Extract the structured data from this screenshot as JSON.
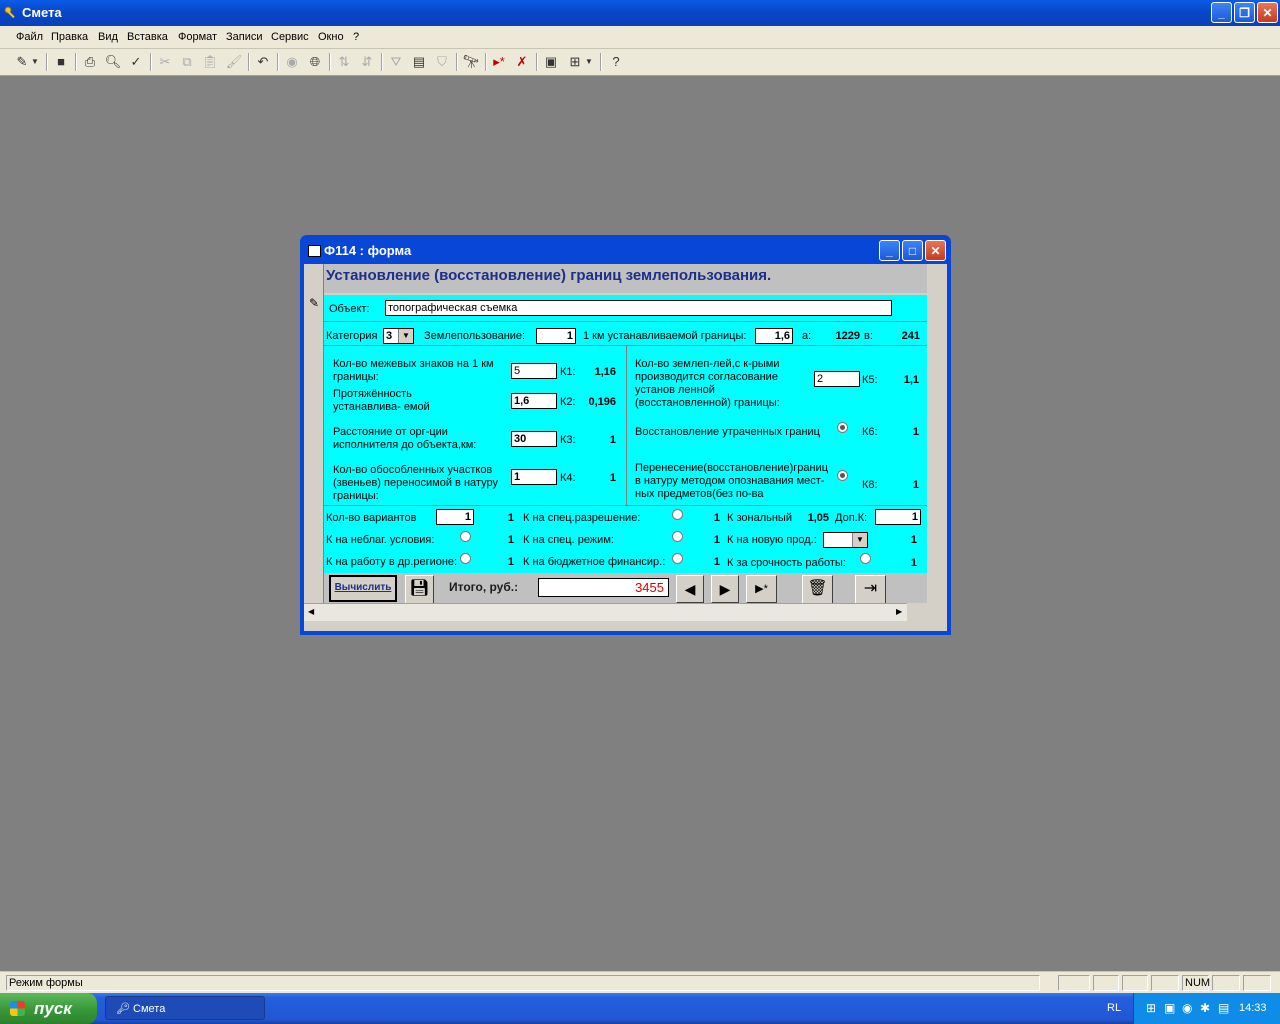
{
  "app": {
    "title": "Смета"
  },
  "menu": [
    "Файл",
    "Правка",
    "Вид",
    "Вставка",
    "Формат",
    "Записи",
    "Сервис",
    "Окно",
    "?"
  ],
  "form": {
    "title": "Ф114 : форма",
    "heading": "Установление (восстановление) границ землепользования.",
    "object_label": "Объект:",
    "object_value": "топографическая съемка",
    "category_label": "Категория",
    "category_value": "3",
    "landuse_label": "Землепользование:",
    "landuse_value": "1",
    "km_label": "1 км устанавливаемой границы:",
    "km_value": "1,6",
    "a_label": "а:",
    "a_value": "1229",
    "v_label": "в:",
    "v_value": "241",
    "left": [
      {
        "label": "Кол-во межевых знаков   на 1 км границы:",
        "input": "5",
        "k_label": "К1:",
        "k_value": "1,16"
      },
      {
        "label": "Протяжённость устанавлива- емой границы:",
        "input": "1,6",
        "k_label": "К2:",
        "k_value": "0,196"
      },
      {
        "label": "Расстояние от орг-ции исполнителя до объекта,км:",
        "input": "30",
        "k_label": "К3:",
        "k_value": "1"
      },
      {
        "label": "Кол-во обособленных участков (звеньев) переносимой в натуру границы:",
        "input": "1",
        "k_label": "К4:",
        "k_value": "1"
      }
    ],
    "right": [
      {
        "label": "Кол-во землеп-лей,с к-рыми производится согласование установ ленной (восстановленной) границы:",
        "input": "2",
        "k_label": "К5:",
        "k_value": "1,1"
      },
      {
        "label": "Восстановление утраченных границ",
        "k_label": "К6:",
        "k_value": "1"
      },
      {
        "label": "Перенесение(восстановление)границ в натуру методом опознавания мест- ных предметов(без по-ва",
        "k_label": "К8:",
        "k_value": "1"
      }
    ],
    "variants_label": "Кол-во вариантов",
    "variants_value": "1",
    "variants_k": "1",
    "unfav_label": "К на неблаг. условия:",
    "unfav_k": "1",
    "region_label": "К на работу в др.регионе:",
    "region_k": "1",
    "spec_perm_label": "К на спец.разрешение:",
    "spec_perm_k": "1",
    "spec_mode_label": "К на спец. режим:",
    "spec_mode_k": "1",
    "budget_label": "К на бюджетное финансир.:",
    "budget_k": "1",
    "zonal_label": "К зональный",
    "zonal_value": "1,05",
    "dopk_label": "Доп.К:",
    "dopk_value": "1",
    "new_prod_label": "К на новую прод.:",
    "new_prod_k": "1",
    "urgent_label": "К за срочность работы:",
    "urgent_k": "1",
    "calc_button": "Вычислить",
    "total_label": "Итого, руб.:",
    "total_value": "3455"
  },
  "status": {
    "mode": "Режим формы",
    "num": "NUM"
  },
  "taskbar": {
    "start": "пуск",
    "item": "Смета",
    "lang": "RL",
    "clock": "14:33"
  }
}
